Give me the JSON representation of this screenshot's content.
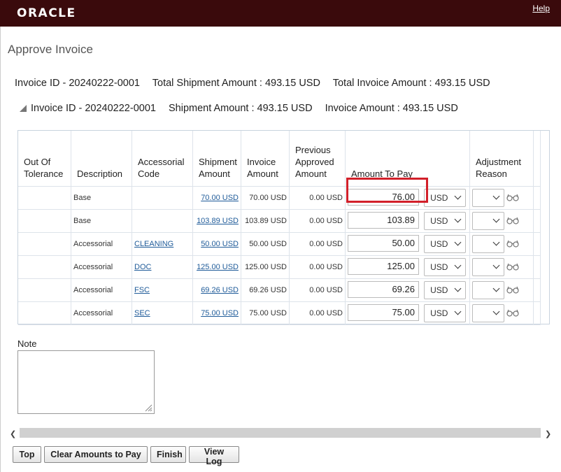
{
  "app": {
    "logo": "ORACLE",
    "help": "Help"
  },
  "page": {
    "title": "Approve Invoice"
  },
  "summary": {
    "invoice_id": "Invoice ID - 20240222-0001",
    "total_shipment": "Total Shipment Amount : 493.15 USD",
    "total_invoice": "Total Invoice Amount : 493.15 USD"
  },
  "group": {
    "invoice_id": "Invoice ID - 20240222-0001",
    "shipment": "Shipment Amount : 493.15 USD",
    "invoice": "Invoice Amount : 493.15 USD"
  },
  "table": {
    "headers": {
      "out_of_tolerance": "Out Of Tolerance",
      "description": "Description",
      "accessorial_code": "Accessorial Code",
      "shipment_amount": "Shipment Amount",
      "invoice_amount": "Invoice Amount",
      "previous_approved": "Previous Approved Amount",
      "amount_to_pay": "Amount To Pay",
      "adjustment_reason": "Adjustment Reason"
    },
    "rows": [
      {
        "description": "Base",
        "code": "",
        "shipment": "70.00 USD",
        "invoice": "70.00 USD",
        "previous": "0.00 USD",
        "pay": "76.00",
        "currency": "USD"
      },
      {
        "description": "Base",
        "code": "",
        "shipment": "103.89 USD",
        "invoice": "103.89 USD",
        "previous": "0.00 USD",
        "pay": "103.89",
        "currency": "USD"
      },
      {
        "description": "Accessorial",
        "code": "CLEANING",
        "shipment": "50.00 USD",
        "invoice": "50.00 USD",
        "previous": "0.00 USD",
        "pay": "50.00",
        "currency": "USD"
      },
      {
        "description": "Accessorial",
        "code": "DOC",
        "shipment": "125.00 USD",
        "invoice": "125.00 USD",
        "previous": "0.00 USD",
        "pay": "125.00",
        "currency": "USD"
      },
      {
        "description": "Accessorial",
        "code": "FSC",
        "shipment": "69.26 USD",
        "invoice": "69.26 USD",
        "previous": "0.00 USD",
        "pay": "69.26",
        "currency": "USD"
      },
      {
        "description": "Accessorial",
        "code": "SEC",
        "shipment": "75.00 USD",
        "invoice": "75.00 USD",
        "previous": "0.00 USD",
        "pay": "75.00",
        "currency": "USD"
      }
    ]
  },
  "note": {
    "label": "Note"
  },
  "buttons": {
    "top": "Top",
    "clear": "Clear Amounts to Pay",
    "finish": "Finish",
    "view_log": "View Log"
  },
  "colors": {
    "header_bar": "#3a0a0c",
    "link": "#1f5b99",
    "highlight": "#d2202a"
  }
}
